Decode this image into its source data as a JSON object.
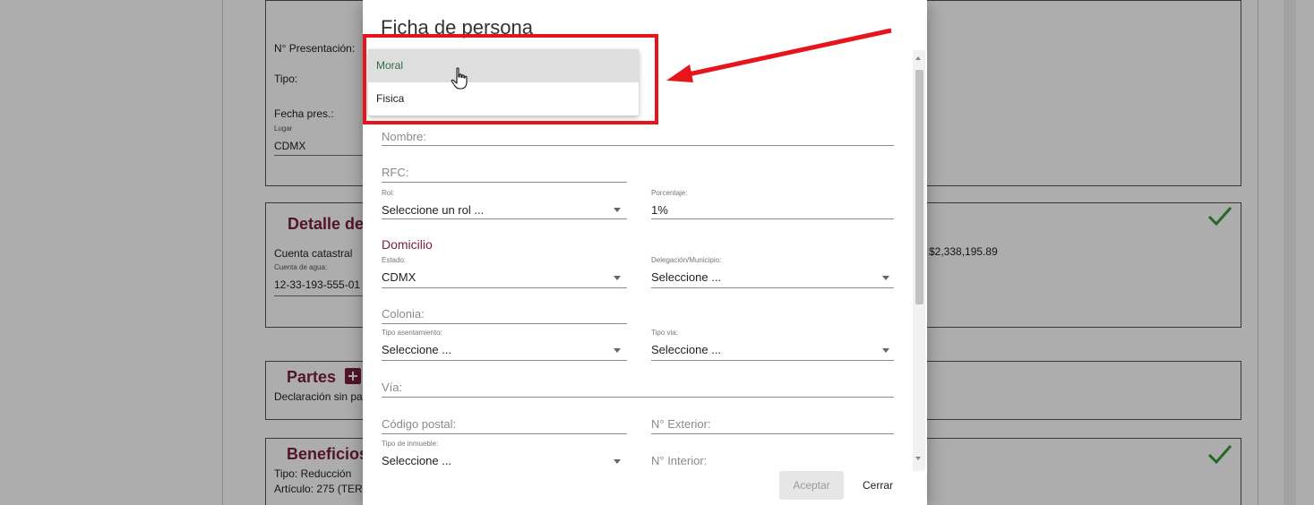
{
  "background": {
    "presentation": {
      "n_presentacion_label": "N° Presentación:",
      "tipo_label": "Tipo:",
      "fecha_label": "Fecha pres.:",
      "lugar_small": "Lugar",
      "lugar_value": "CDMX"
    },
    "detalle": {
      "title": "Detalle del",
      "cuenta_catastral": "Cuenta catastral",
      "cuenta_agua_small": "Cuenta de agua:",
      "cuenta_agua_value": "12-33-193-555-01",
      "amount": "$2,338,195.89"
    },
    "partes": {
      "title": "Partes",
      "text": "Declaración sin pa"
    },
    "beneficios": {
      "title": "Beneficios",
      "tipo": "Tipo: Reducción",
      "articulo": "Artículo: 275 (TER"
    }
  },
  "dialog": {
    "title": "Ficha de persona",
    "fields": {
      "nombre": "Nombre:",
      "rfc": "RFC:",
      "rol_small": "Rol:",
      "rol_value": "Seleccione un rol ...",
      "porcentaje_small": "Porcentaje:",
      "porcentaje_value": "1%",
      "domicilio_title": "Domicilio",
      "estado_small": "Estado:",
      "estado_value": "CDMX",
      "delegacion_small": "Delegación/Municipio:",
      "delegacion_value": "Seleccione ...",
      "colonia": "Colonia:",
      "tipo_asent_small": "Tipo asentamiento:",
      "tipo_asent_value": "Seleccione ...",
      "tipo_via_small": "Tipo via:",
      "tipo_via_value": "Seleccione ...",
      "via": "Vía:",
      "codigo_postal": "Código postal:",
      "n_exterior": "N° Exterior:",
      "tipo_inmueble_small": "Tipo de inmueble:",
      "tipo_inmueble_value": "Seleccione ...",
      "n_interior": "N° Interior:"
    },
    "buttons": {
      "accept": "Aceptar",
      "close": "Cerrar"
    }
  },
  "dropdown": {
    "options": [
      "Moral",
      "Fisica"
    ],
    "selected": "Moral"
  },
  "colors": {
    "accent": "#7a1e3a",
    "highlight": "#e8141c",
    "check": "#3a9a3a"
  },
  "icons": {
    "pointer": "hand-pointer-icon",
    "check": "check-icon",
    "add": "plus-icon"
  }
}
